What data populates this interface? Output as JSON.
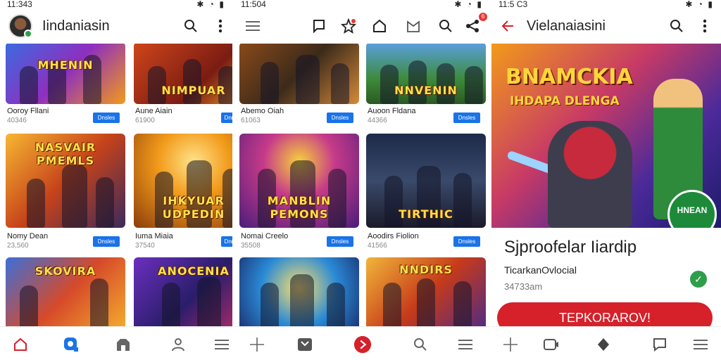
{
  "panel1": {
    "status_time": "11:343",
    "status_icons": "✱ ◔ ▮",
    "app_title": "Iindaniasin",
    "cards": [
      {
        "logo": "MHENIN",
        "title": "Ooroy Fllani",
        "sub": "40346",
        "badge": "Dnsles"
      },
      {
        "logo": "NIMPUAR",
        "title": "Aune Aiain",
        "sub": "61900",
        "badge": "Dnnsles"
      },
      {
        "logo": "NASVAIR PMEMLS",
        "title": "Nomy Dean",
        "sub": "23,560",
        "badge": "Dnsles"
      },
      {
        "logo": "IHKYUAR UDPEDIN",
        "title": "Iuma Miaia",
        "sub": "37540",
        "badge": "Dnnsles"
      },
      {
        "logo": "SKOVIRA",
        "title": "",
        "sub": "",
        "badge": ""
      },
      {
        "logo": "ANOCENIA",
        "title": "",
        "sub": "",
        "badge": ""
      }
    ]
  },
  "panel2": {
    "status_time": "11:504",
    "status_icons": "✱ ◔ ▮",
    "cards": [
      {
        "logo": "",
        "title": "Abemo Oiah",
        "sub": "61063",
        "badge": "Dnsles"
      },
      {
        "logo": "NNVENIN",
        "title": "Auoon Fldana",
        "sub": "44366",
        "badge": "Dnsles"
      },
      {
        "logo": "MANBLIN PEMONS",
        "title": "Nomai Creelo",
        "sub": "35508",
        "badge": "Dnsles"
      },
      {
        "logo": "TIRTHIC",
        "title": "Aoodirs Fiolion",
        "sub": "41566",
        "badge": "Dnsles"
      },
      {
        "logo": "",
        "title": "",
        "sub": "",
        "badge": ""
      },
      {
        "logo": "NNDIRS",
        "title": "",
        "sub": "",
        "badge": ""
      }
    ],
    "notification_count": "6"
  },
  "panel3": {
    "status_time": "11:5 C3",
    "status_icons": "✱ ◔ ▮",
    "app_title": "Vielanaiasini",
    "hero_title": "BNAMCKIA",
    "hero_subtitle": "IHDAPA DLENGA",
    "hero_stamp": "HNEAN",
    "detail_title": "Sjproofelar Iiardip",
    "developer": "TicarkanOvlocial",
    "downloads": "34733am",
    "install_label": "TEPKORAROV!"
  },
  "colors": {
    "accent": "#d6202a",
    "nav_active": "#1a73e8",
    "badge": "#1a73e8"
  }
}
